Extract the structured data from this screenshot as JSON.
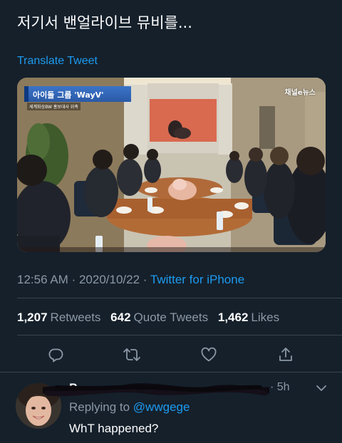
{
  "tweet": {
    "text": "저기서 밴얼라이브 뮤비를...",
    "translate_label": "Translate Tweet"
  },
  "media": {
    "caption": "아이돌 그룹 'WayV'",
    "caption_sub": "세계화상BW 홍보대사 위촉",
    "channel_logo": "채널e뉴스"
  },
  "meta": {
    "time": "12:56 AM",
    "separator1": "·",
    "date": "2020/10/22",
    "separator2": "·",
    "source": "Twitter for iPhone"
  },
  "stats": {
    "retweets_count": "1,207",
    "retweets_label": "Retweets",
    "quotes_count": "642",
    "quotes_label": "Quote Tweets",
    "likes_count": "1,462",
    "likes_label": "Likes"
  },
  "actions": {
    "icons": [
      "reply-icon",
      "retweet-icon",
      "like-icon",
      "share-icon"
    ]
  },
  "reply": {
    "name_visible": "P",
    "time": "· 5h",
    "replying_prefix": "Replying to",
    "replying_handle": "@wwgege",
    "text": "WhT happened?"
  },
  "colors": {
    "background": "#15202b",
    "accent": "#1d9bf0",
    "secondary_text": "#8b98a5",
    "divider": "#38444d"
  }
}
